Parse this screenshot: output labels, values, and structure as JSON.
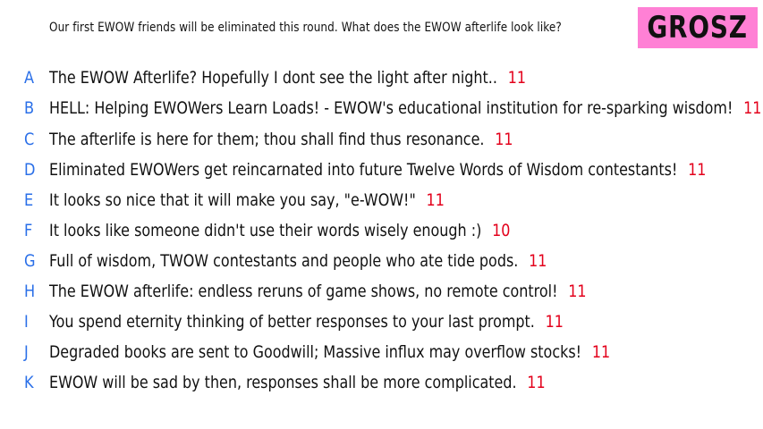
{
  "prompt": "Our first EWOW friends will be eliminated this round. What does the EWOW afterlife look like?",
  "badge": {
    "label": "GROSZ",
    "color": "#ff80d5"
  },
  "colors": {
    "letter": "#2a6fe8",
    "count": "#e3001b",
    "text": "#111111"
  },
  "responses": [
    {
      "letter": "A",
      "text": "The EWOW Afterlife? Hopefully I dont see the light after night..",
      "count": "11"
    },
    {
      "letter": "B",
      "text": "HELL: Helping EWOWers Learn Loads! - EWOW's educational institution for re-sparking wisdom!",
      "count": "11"
    },
    {
      "letter": "C",
      "text": "The afterlife is here for them; thou shall find thus resonance.",
      "count": "11"
    },
    {
      "letter": "D",
      "text": "Eliminated EWOWers get reincarnated into future Twelve Words of Wisdom contestants!",
      "count": "11"
    },
    {
      "letter": "E",
      "text": "It looks so nice that it will make you say, \"e-WOW!\"",
      "count": "11"
    },
    {
      "letter": "F",
      "text": "It looks like someone didn't use their words wisely enough :)",
      "count": "10"
    },
    {
      "letter": "G",
      "text": "Full of wisdom, TWOW contestants and people who ate tide pods.",
      "count": "11"
    },
    {
      "letter": "H",
      "text": "The EWOW afterlife: endless reruns of game shows, no remote control!",
      "count": "11"
    },
    {
      "letter": "I",
      "text": "You spend eternity thinking of better responses to your last prompt.",
      "count": "11"
    },
    {
      "letter": "J",
      "text": "Degraded books are sent to Goodwill; Massive influx may overflow stocks!",
      "count": "11"
    },
    {
      "letter": "K",
      "text": "EWOW will be sad by then, responses shall be more complicated.",
      "count": "11"
    }
  ]
}
